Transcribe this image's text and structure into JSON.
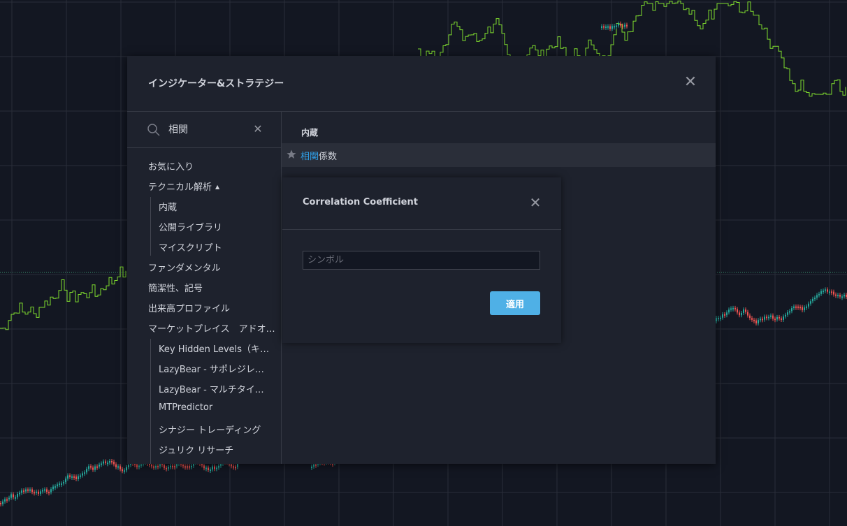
{
  "dialog": {
    "title": "インジケーター&ストラテジー",
    "search": {
      "value": "相関",
      "placeholder": ""
    },
    "categories": {
      "favorites": "お気に入り",
      "technical": "テクニカル解析",
      "technical_sub": [
        "内蔵",
        "公開ライブラリ",
        "マイスクリプト"
      ],
      "fundamental": "ファンダメンタル",
      "candlestick": "簡潔性、記号",
      "volume_profile": "出来高プロファイル",
      "marketplace": "マーケットプレイス　アドオ…",
      "marketplace_sub": [
        "Key Hidden Levels（キー…",
        "LazyBear - サポレジレベル",
        "LazyBear - マルチタイムフ…",
        "MTPredictor",
        "シナジー トレーディング",
        "ジュリク リサーチ"
      ]
    },
    "results": {
      "section_label": "内蔵",
      "items": [
        {
          "highlight": "相関",
          "rest": "係数"
        }
      ]
    }
  },
  "popup": {
    "title": "Correlation Coefficient",
    "symbol_placeholder": "シンボル",
    "symbol_value": "",
    "apply_label": "適用"
  },
  "colors": {
    "background": "#131722",
    "panel": "#1e222d",
    "highlight_text": "#2f9ee6",
    "apply_button": "#4fb0e6",
    "line_series": "#7fdc2e",
    "candle_up": "#26a69a",
    "candle_down": "#ef5350"
  }
}
